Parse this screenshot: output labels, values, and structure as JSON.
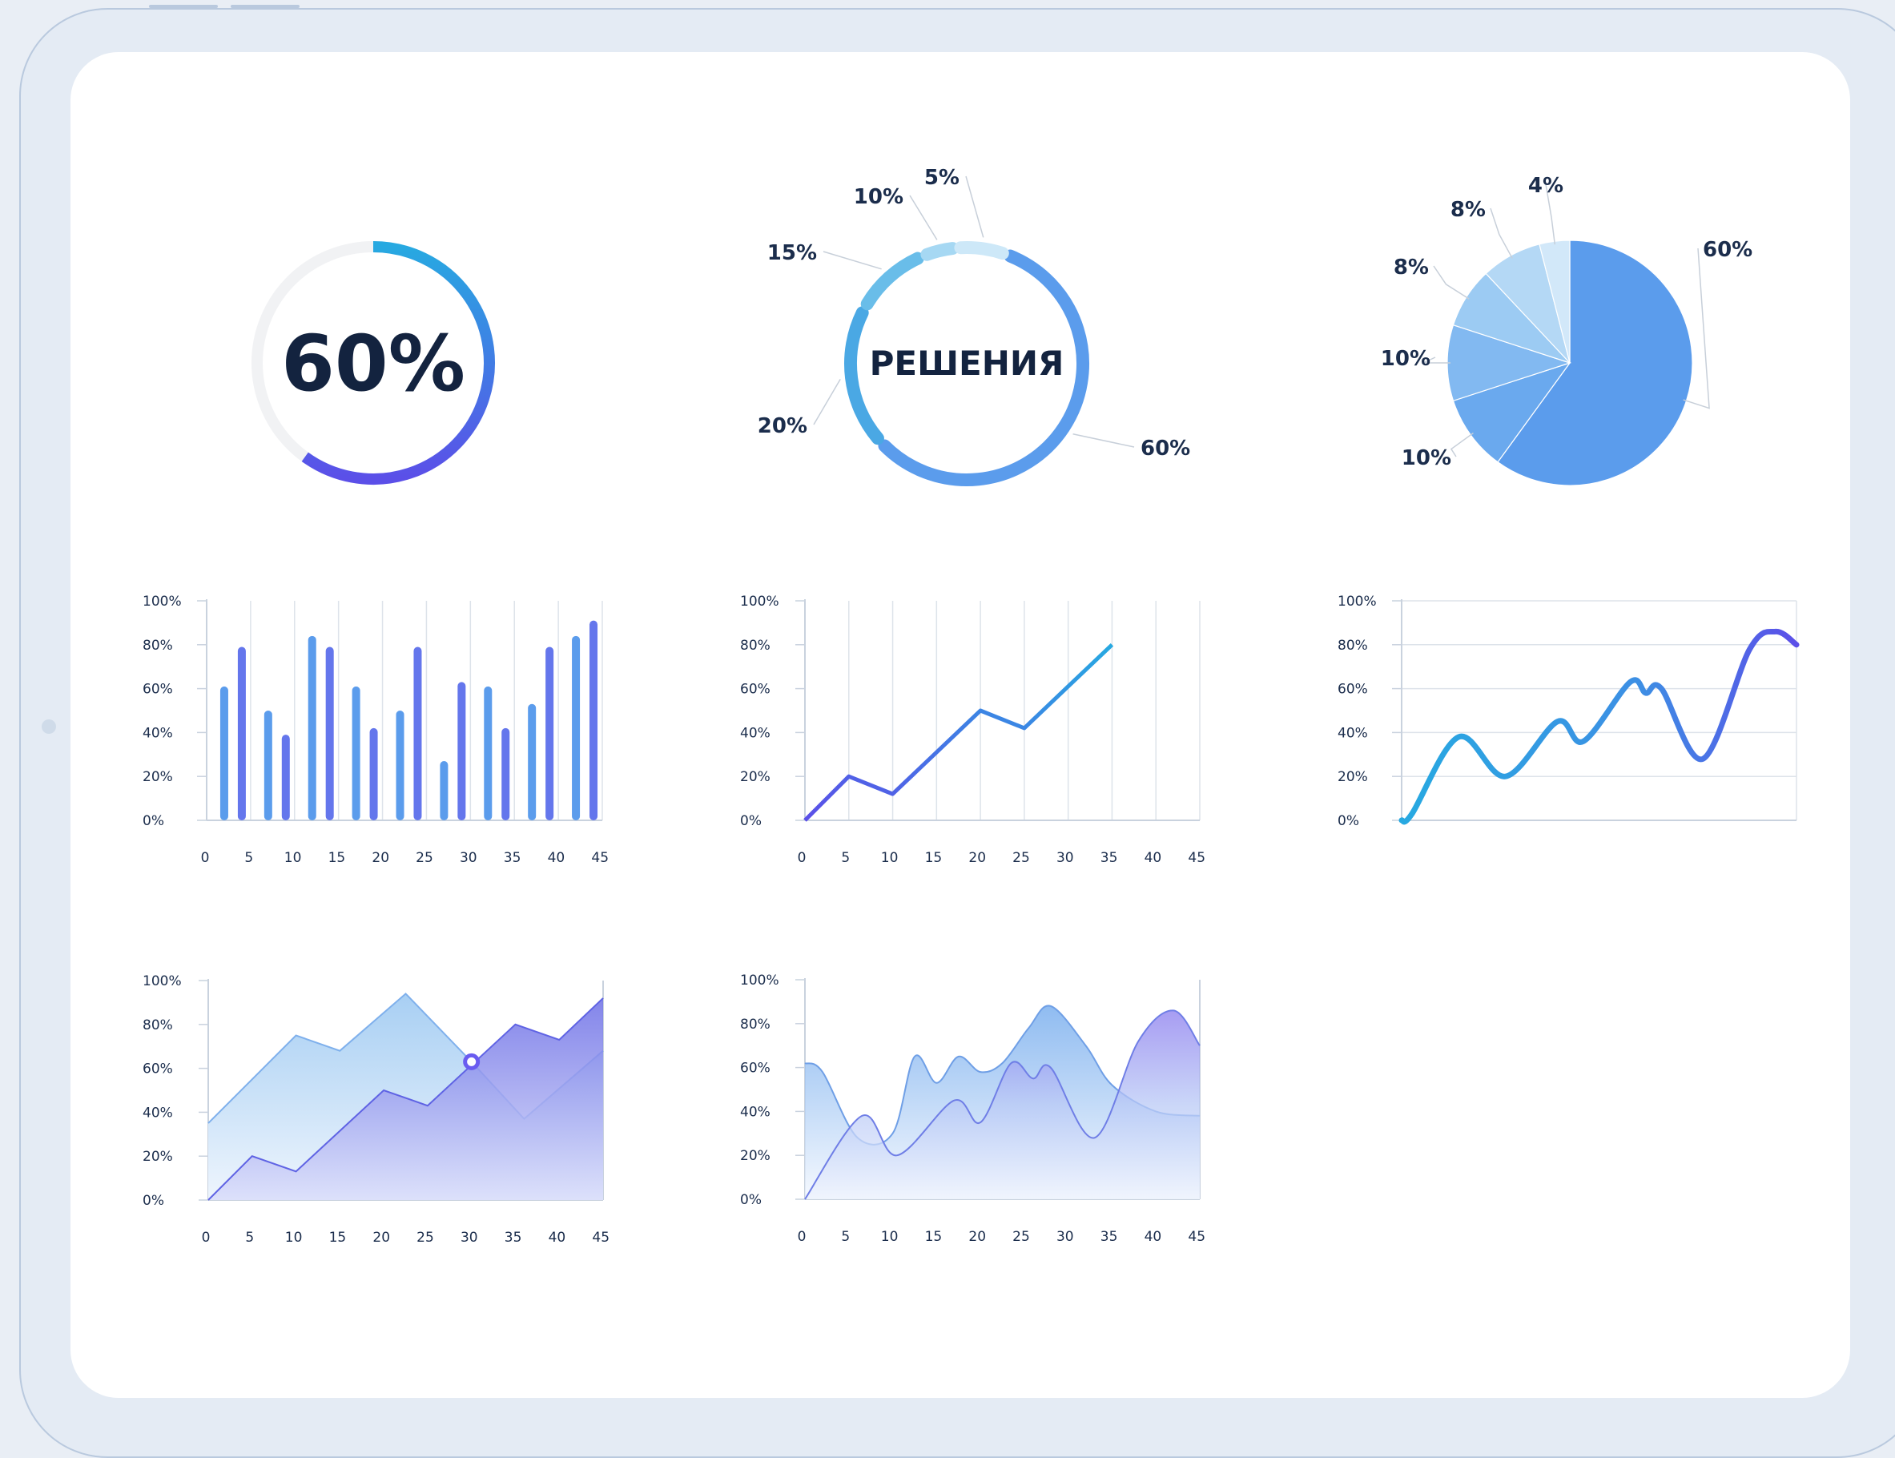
{
  "colors": {
    "blue": "#5b9cec",
    "blue_light": "#8fc3ee",
    "cyan": "#27a9e1",
    "violet": "#5b4fe8",
    "indigo": "#6476ec",
    "track": "#f1f2f4",
    "text": "#1b2d4c",
    "grid": "#dde3ea"
  },
  "chart_data": [
    {
      "type": "donut",
      "center_text": "60%",
      "values": [
        60
      ]
    },
    {
      "type": "donut",
      "center_text": "РЕШЕНИЯ",
      "slices": [
        {
          "label": "60%",
          "value": 60
        },
        {
          "label": "20%",
          "value": 20
        },
        {
          "label": "15%",
          "value": 15
        },
        {
          "label": "10%",
          "value": 10
        },
        {
          "label": "5%",
          "value": 5
        }
      ]
    },
    {
      "type": "pie",
      "slices": [
        {
          "label": "60%",
          "value": 60
        },
        {
          "label": "10%",
          "value": 10
        },
        {
          "label": "10%",
          "value": 10
        },
        {
          "label": "8%",
          "value": 8
        },
        {
          "label": "8%",
          "value": 8
        },
        {
          "label": "4%",
          "value": 4
        }
      ]
    },
    {
      "type": "bar",
      "x": [
        2,
        4,
        7,
        9,
        12,
        14,
        17,
        19,
        22,
        24,
        27,
        29,
        32,
        34,
        37,
        39,
        42,
        44
      ],
      "values": [
        61,
        79,
        50,
        39,
        84,
        79,
        61,
        42,
        50,
        79,
        27,
        63,
        61,
        42,
        53,
        79,
        84,
        91
      ],
      "xticks": [
        "0",
        "5",
        "10",
        "15",
        "20",
        "25",
        "30",
        "35",
        "40",
        "45"
      ],
      "yticks": [
        "0%",
        "20%",
        "40%",
        "60%",
        "80%",
        "100%"
      ],
      "xlim": [
        0,
        45
      ],
      "ylim": [
        0,
        100
      ]
    },
    {
      "type": "line",
      "x": [
        0,
        5,
        10,
        15,
        20,
        25,
        30,
        35
      ],
      "values": [
        0,
        20,
        12,
        31,
        50,
        42,
        61,
        80
      ],
      "xticks": [
        "0",
        "5",
        "10",
        "15",
        "20",
        "25",
        "30",
        "35",
        "40",
        "45"
      ],
      "yticks": [
        "0%",
        "20%",
        "40%",
        "60%",
        "80%",
        "100%"
      ],
      "xlim": [
        0,
        45
      ],
      "ylim": [
        0,
        100
      ],
      "grid": "vertical"
    },
    {
      "type": "line",
      "smooth": true,
      "x": [
        0,
        1,
        5.5,
        10,
        15,
        17.5,
        22,
        23.5,
        25,
        29,
        33.5,
        36,
        38
      ],
      "values": [
        0,
        3,
        38,
        20,
        45,
        36,
        63,
        58,
        60,
        28,
        78,
        86,
        80
      ],
      "xlim": [
        0,
        38
      ],
      "yticks": [
        "0%",
        "20%",
        "40%",
        "60%",
        "80%",
        "100%"
      ],
      "ylim": [
        0,
        100
      ],
      "grid": "horizontal"
    },
    {
      "type": "area",
      "series": [
        {
          "x": [
            0,
            10,
            15,
            22.5,
            30,
            36,
            45
          ],
          "values": [
            35,
            75,
            68,
            94,
            63,
            37,
            68
          ]
        },
        {
          "x": [
            0,
            5,
            10,
            20,
            25,
            35,
            40,
            45
          ],
          "values": [
            0,
            20,
            13,
            50,
            43,
            80,
            73,
            92
          ]
        }
      ],
      "marker": {
        "x": 30,
        "y": 63
      },
      "xticks": [
        "0",
        "5",
        "10",
        "15",
        "20",
        "25",
        "30",
        "35",
        "40",
        "45"
      ],
      "yticks": [
        "0%",
        "20%",
        "40%",
        "60%",
        "80%",
        "100%"
      ],
      "xlim": [
        0,
        45
      ],
      "ylim": [
        0,
        100
      ]
    },
    {
      "type": "area",
      "smooth": true,
      "series": [
        {
          "x": [
            0,
            2,
            6,
            10,
            12.5,
            15,
            17.5,
            20,
            22.5,
            25.5,
            28,
            32,
            35,
            40,
            45
          ],
          "values": [
            62,
            58,
            28,
            30,
            65,
            53,
            65,
            58,
            62,
            78,
            88,
            70,
            52,
            40,
            38
          ]
        },
        {
          "x": [
            0,
            6.5,
            10.5,
            17,
            20,
            23.5,
            26,
            28,
            33,
            38,
            42,
            45
          ],
          "values": [
            0,
            38,
            20,
            45,
            35,
            62,
            55,
            60,
            28,
            72,
            86,
            70
          ]
        }
      ],
      "xticks": [
        "0",
        "5",
        "10",
        "15",
        "20",
        "25",
        "30",
        "35",
        "40",
        "45"
      ],
      "yticks": [
        "0%",
        "20%",
        "40%",
        "60%",
        "80%",
        "100%"
      ],
      "xlim": [
        0,
        45
      ],
      "ylim": [
        0,
        100
      ]
    }
  ]
}
